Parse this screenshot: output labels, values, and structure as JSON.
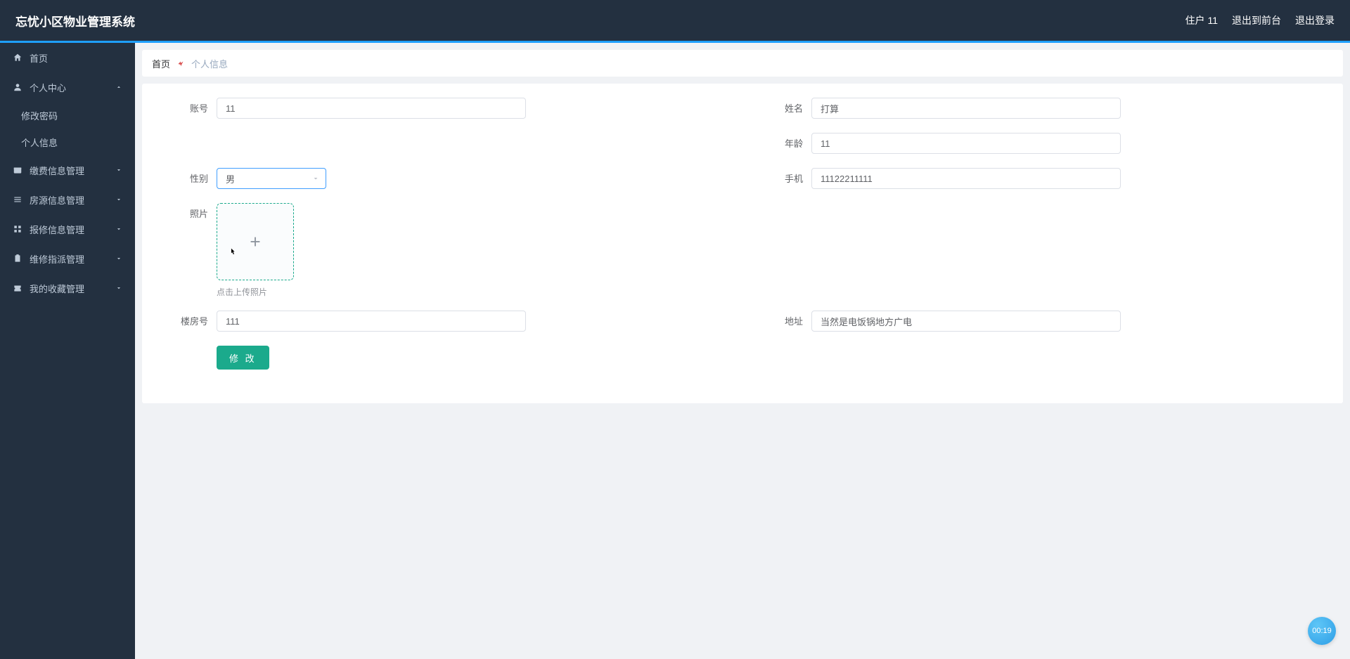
{
  "header": {
    "title": "忘忧小区物业管理系统",
    "user_label": "住户 11",
    "frontend_link": "退出到前台",
    "logout_link": "退出登录"
  },
  "sidebar": {
    "home": "首页",
    "personal_center": "个人中心",
    "change_password": "修改密码",
    "personal_info": "个人信息",
    "payment_mgmt": "缴费信息管理",
    "housing_mgmt": "房源信息管理",
    "repair_mgmt": "报修信息管理",
    "dispatch_mgmt": "维修指派管理",
    "favorite_mgmt": "我的收藏管理"
  },
  "breadcrumb": {
    "home": "首页",
    "current": "个人信息"
  },
  "form": {
    "labels": {
      "account": "账号",
      "name": "姓名",
      "age": "年龄",
      "gender": "性别",
      "phone": "手机",
      "photo": "照片",
      "building": "楼房号",
      "address": "地址"
    },
    "values": {
      "account": "11",
      "name": "打算",
      "age": "11",
      "gender": "男",
      "phone": "11122211111",
      "building": "111",
      "address": "当然是电饭锅地方广电"
    },
    "upload_hint": "点击上传照片",
    "submit": "修 改"
  },
  "timer": "00:19"
}
